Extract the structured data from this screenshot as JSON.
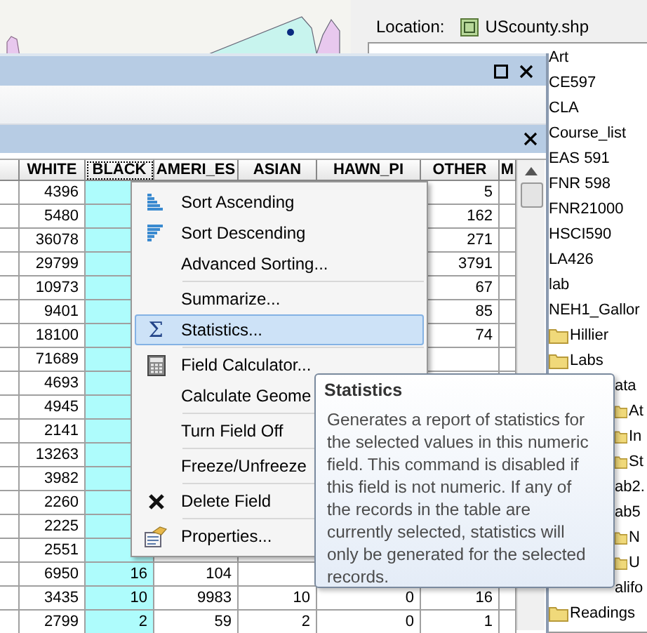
{
  "catalog": {
    "location_label": "Location:",
    "location_value": "UScounty.shp",
    "tree": [
      {
        "label": "Art",
        "kind": "plain"
      },
      {
        "label": "CE597",
        "kind": "plain"
      },
      {
        "label": "CLA",
        "kind": "plain"
      },
      {
        "label": "Course_list",
        "kind": "plain"
      },
      {
        "label": "EAS 591",
        "kind": "plain"
      },
      {
        "label": "FNR 598",
        "kind": "plain"
      },
      {
        "label": "FNR21000",
        "kind": "plain"
      },
      {
        "label": "HSCI590",
        "kind": "plain"
      },
      {
        "label": "LA426",
        "kind": "plain"
      },
      {
        "label": "lab",
        "kind": "plain"
      },
      {
        "label": "NEH1_Gallor",
        "kind": "plain",
        "children": [
          {
            "label": "Hillier",
            "kind": "folder"
          },
          {
            "label": "Labs",
            "kind": "folder",
            "children": [
              {
                "label": "ata",
                "kind": "plain",
                "children": [
                  {
                    "label": "At",
                    "kind": "folder"
                  },
                  {
                    "label": "In",
                    "kind": "folder"
                  },
                  {
                    "label": "St",
                    "kind": "folder"
                  }
                ]
              },
              {
                "label": "ab2.",
                "kind": "plain"
              },
              {
                "label": "ab5",
                "kind": "plain",
                "children": [
                  {
                    "label": "N",
                    "kind": "folder"
                  },
                  {
                    "label": "U",
                    "kind": "folder"
                  }
                ]
              },
              {
                "label": "alifo",
                "kind": "plain"
              }
            ]
          },
          {
            "label": "Readings",
            "kind": "folder"
          }
        ]
      }
    ]
  },
  "table": {
    "columns": [
      {
        "label": "WHITE",
        "selected": false
      },
      {
        "label": "BLACK",
        "selected": true
      },
      {
        "label": "AMERI_ES",
        "selected": false
      },
      {
        "label": "ASIAN",
        "selected": false
      },
      {
        "label": "HAWN_PI",
        "selected": false
      },
      {
        "label": "OTHER",
        "selected": false
      },
      {
        "label": "M",
        "selected": false
      }
    ],
    "rows": [
      [
        "4396",
        null,
        null,
        null,
        null,
        "5",
        null
      ],
      [
        "5480",
        null,
        null,
        null,
        null,
        "162",
        null
      ],
      [
        "36078",
        null,
        null,
        null,
        null,
        "271",
        null
      ],
      [
        "29799",
        null,
        null,
        null,
        null,
        "3791",
        null
      ],
      [
        "10973",
        null,
        null,
        null,
        null,
        "67",
        null
      ],
      [
        "9401",
        null,
        null,
        null,
        null,
        "85",
        null
      ],
      [
        "18100",
        null,
        null,
        null,
        null,
        "74",
        null
      ],
      [
        "71689",
        null,
        null,
        null,
        null,
        null,
        null
      ],
      [
        "4693",
        null,
        null,
        null,
        null,
        null,
        null
      ],
      [
        "4945",
        null,
        null,
        null,
        null,
        null,
        null
      ],
      [
        "2141",
        null,
        null,
        null,
        null,
        null,
        null
      ],
      [
        "13263",
        null,
        null,
        null,
        null,
        null,
        null
      ],
      [
        "3982",
        null,
        null,
        null,
        null,
        null,
        null
      ],
      [
        "2260",
        null,
        null,
        null,
        null,
        null,
        null
      ],
      [
        "2225",
        null,
        null,
        null,
        null,
        null,
        null
      ],
      [
        "2551",
        null,
        null,
        null,
        null,
        null,
        null
      ],
      [
        "6950",
        "16",
        "104",
        null,
        null,
        null,
        null
      ],
      [
        "3435",
        "10",
        "9983",
        "10",
        "0",
        "16",
        null
      ],
      [
        "2799",
        "2",
        "59",
        "2",
        "0",
        "1",
        null
      ]
    ]
  },
  "context_menu": {
    "groups": [
      [
        {
          "label": "Sort Ascending",
          "selected": false
        },
        {
          "label": "Sort Descending",
          "selected": false
        },
        {
          "label": "Advanced Sorting...",
          "selected": false
        }
      ],
      [
        {
          "label": "Summarize...",
          "selected": false
        },
        {
          "label": "Statistics...",
          "selected": true,
          "glyph": "Σ"
        }
      ],
      [
        {
          "label": "Field Calculator...",
          "selected": false
        },
        {
          "label": "Calculate Geome",
          "selected": false
        }
      ],
      [
        {
          "label": "Turn Field Off",
          "selected": false
        }
      ],
      [
        {
          "label": "Freeze/Unfreeze",
          "selected": false
        }
      ],
      [
        {
          "label": "Delete Field",
          "selected": false
        }
      ],
      [
        {
          "label": "Properties...",
          "selected": false
        }
      ]
    ]
  },
  "tooltip": {
    "title": "Statistics",
    "text": "Generates a report of statistics for the selected values in this numeric field. This command is disabled if this field is not numeric. If any of the records in the table are currently selected, statistics will only be generated for the selected records."
  }
}
